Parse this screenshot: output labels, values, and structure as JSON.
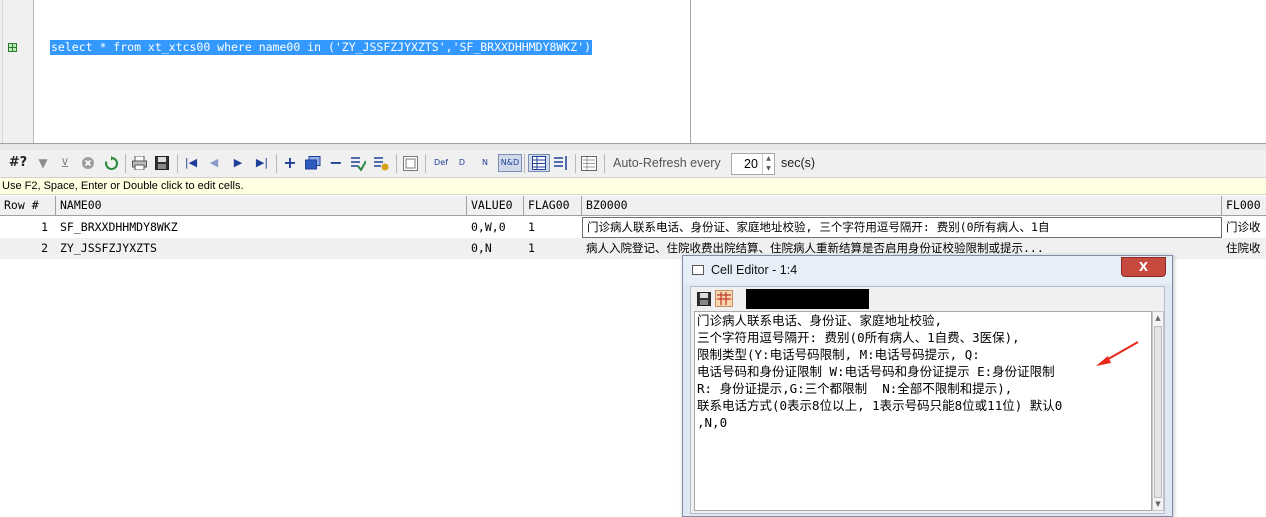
{
  "editor": {
    "sql": "select * from xt_xtcs00 where name00 in ('ZY_JSSFZJYXZTS','SF_BRXXDHHMDY8WKZ')",
    "exec_icon": "grid-icon"
  },
  "toolbar": {
    "query_by_example": "#?",
    "filter_icon": "filter-icon",
    "auto_refresh_label": "Auto-Refresh every",
    "auto_refresh_value": "20",
    "auto_refresh_unit": "sec(s)",
    "def_label": "Def",
    "d_label": "D",
    "n_label": "N",
    "nd_label": "N&D"
  },
  "hint": "Use F2, Space, Enter or Double click to edit cells.",
  "grid": {
    "columns": [
      "Row #",
      "NAME00",
      "VALUE0",
      "FLAG00",
      "BZ0000",
      "FL000"
    ],
    "rows": [
      {
        "row": "1",
        "name": "SF_BRXXDHHMDY8WKZ",
        "value": "0,W,0",
        "flag": "1",
        "bz": "门诊病人联系电话、身份证、家庭地址校验, 三个字符用逗号隔开: 费别(0所有病人、1自",
        "fl": "门诊收"
      },
      {
        "row": "2",
        "name": "ZY_JSSFZJYXZTS",
        "value": "0,N",
        "flag": "1",
        "bz": "病人入院登记、住院收费出院结算、住院病人重新结算是否启用身份证校验限制或提示...",
        "fl": "住院收"
      }
    ]
  },
  "cell_editor": {
    "title": "Cell Editor - 1:4",
    "close_label": "X",
    "lines": [
      "门诊病人联系电话、身份证、家庭地址校验,",
      "三个字符用逗号隔开: 费别(0所有病人、1自费、3医保),",
      "限制类型(Y:电话号码限制, M:电话号码提示, Q:",
      "电话号码和身份证限制 W:电话号码和身份证提示 E:身份证限制",
      "R: 身份证提示,G:三个都限制  N:全部不限制和提示),",
      "联系电话方式(0表示8位以上, 1表示号码只能8位或11位) 默认0",
      ",N,0"
    ],
    "annotation_color": "#e8271b"
  }
}
